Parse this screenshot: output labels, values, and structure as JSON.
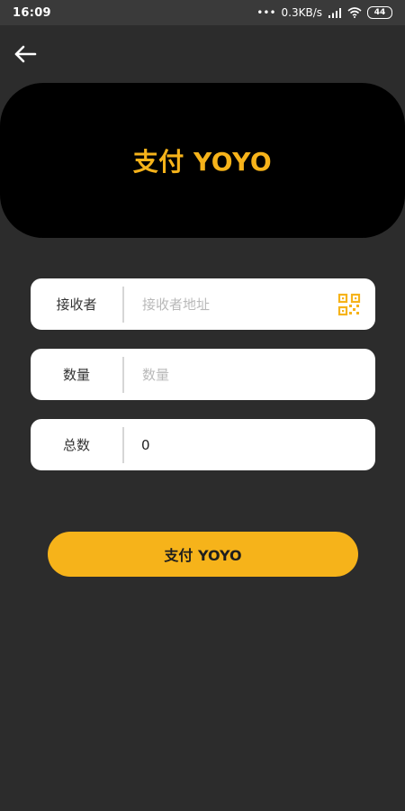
{
  "status_bar": {
    "time": "16:09",
    "network_speed": "0.3KB/s",
    "dots": "•••",
    "battery": "44",
    "icons": [
      "signal-icon",
      "wifi-icon",
      "battery-icon"
    ]
  },
  "header": {
    "back_icon": "back-arrow-icon",
    "title": "支付 YOYO"
  },
  "form": {
    "receiver": {
      "label": "接收者",
      "placeholder": "接收者地址",
      "value": "",
      "action_icon": "qr-code-icon"
    },
    "amount": {
      "label": "数量",
      "placeholder": "数量",
      "value": ""
    },
    "total": {
      "label": "总数",
      "value": "0"
    }
  },
  "actions": {
    "pay_label": "支付 YOYO"
  },
  "colors": {
    "background": "#2c2c2c",
    "accent": "#f6b31a",
    "card": "#000000",
    "field": "#ffffff"
  }
}
